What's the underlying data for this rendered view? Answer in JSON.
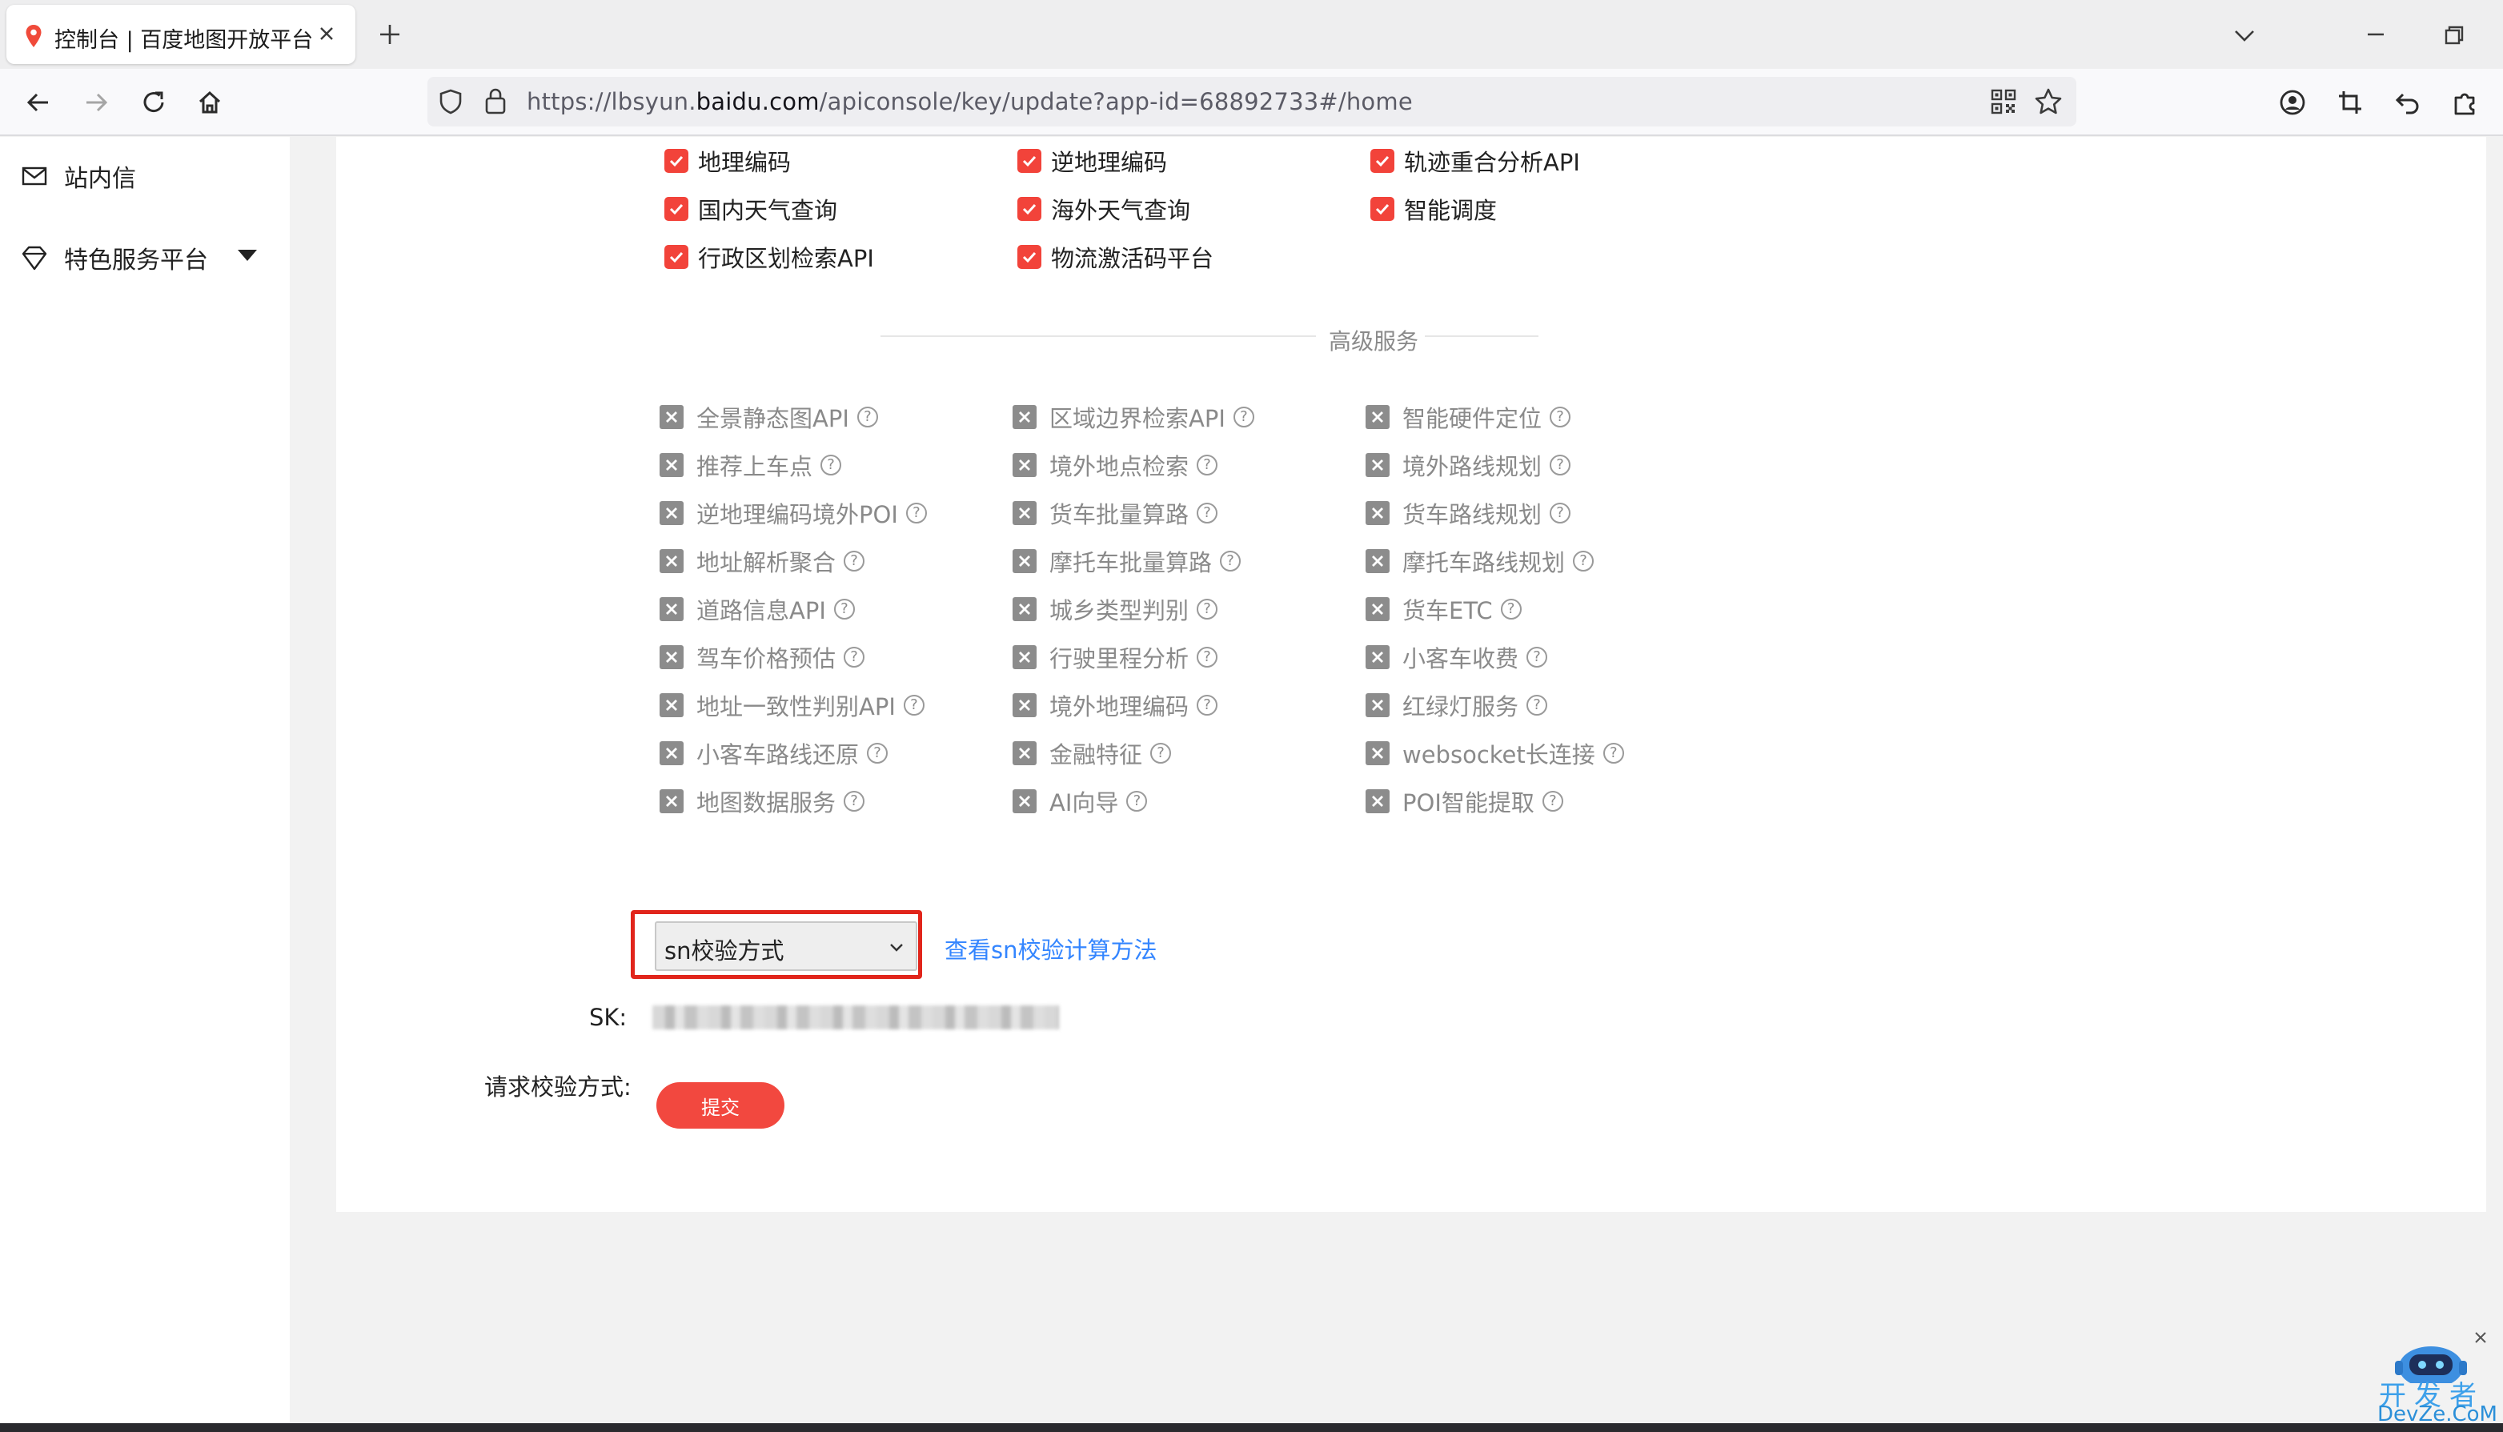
{
  "browser": {
    "tab_title": "控制台 | 百度地图开放平台",
    "url_prefix": "https://lbsyun.",
    "url_domain": "baidu.com",
    "url_suffix": "/apiconsole/key/update?app-id=68892733#/home"
  },
  "sidebar": {
    "items": [
      {
        "label": "站内信",
        "icon": "mail-icon"
      },
      {
        "label": "特色服务平台",
        "icon": "diamond-icon",
        "expandable": true
      }
    ]
  },
  "enabled_services": [
    "地理编码",
    "逆地理编码",
    "轨迹重合分析API",
    "国内天气查询",
    "海外天气查询",
    "智能调度",
    "行政区划检索API",
    "物流激活码平台"
  ],
  "advanced_section_title": "高级服务",
  "advanced_services": [
    "全景静态图API",
    "区域边界检索API",
    "智能硬件定位",
    "推荐上车点",
    "境外地点检索",
    "境外路线规划",
    "逆地理编码境外POI",
    "货车批量算路",
    "货车路线规划",
    "地址解析聚合",
    "摩托车批量算路",
    "摩托车路线规划",
    "道路信息API",
    "城乡类型判别",
    "货车ETC",
    "驾车价格预估",
    "行驶里程分析",
    "小客车收费",
    "地址一致性判别API",
    "境外地理编码",
    "红绿灯服务",
    "小客车路线还原",
    "金融特征",
    "websocket长连接",
    "地图数据服务",
    "AI向导",
    "POI智能提取"
  ],
  "form": {
    "verify_label": "请求校验方式:",
    "verify_value": "sn校验方式",
    "sn_link": "查看sn校验计算方法",
    "sk_label": "SK:",
    "submit_label": "提交"
  },
  "watermark": {
    "line1": "开发者",
    "line2": "DevZe.CoM"
  },
  "colors": {
    "accent_red": "#f2433a",
    "link_blue": "#3385ff",
    "highlight_red": "#e1251b"
  }
}
